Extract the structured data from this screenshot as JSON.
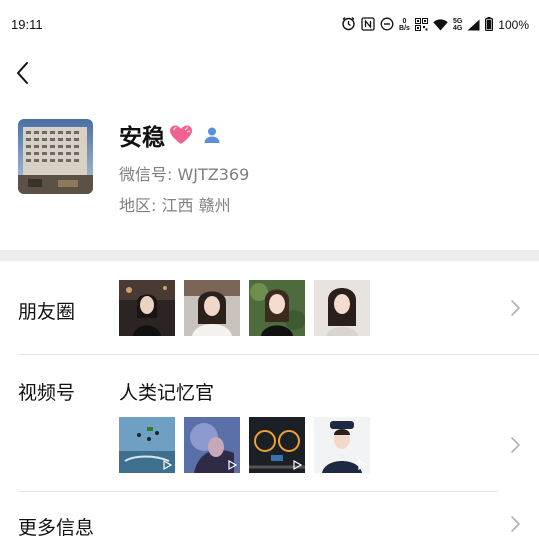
{
  "status_bar": {
    "time": "19:11",
    "net_speed_top": "0",
    "net_speed_bottom": "B/s",
    "network_top": "5G",
    "network_bottom": "4G",
    "battery": "100%"
  },
  "profile": {
    "nickname": "安稳",
    "wechat_id": "微信号:  WJTZ369",
    "region": "地区:  江西  赣州"
  },
  "moments": {
    "label": "朋友圈"
  },
  "channels": {
    "label": "视频号",
    "channel_name": "人类记忆官"
  },
  "more_info": {
    "label": "更多信息"
  },
  "colors": {
    "background": "#ffffff",
    "band": "#ededed",
    "secondary_text": "#7f7f7f",
    "contact_icon": "#5b8fd9",
    "heart": "#f06292"
  }
}
